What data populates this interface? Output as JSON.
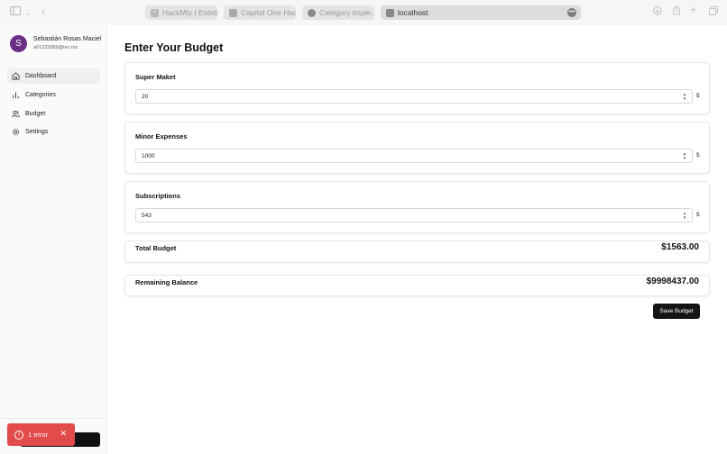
{
  "browser": {
    "tabs": [
      {
        "label": "HackMty | Esteb...",
        "icon": "tab-favicon"
      },
      {
        "label": "Capital One Hac...",
        "icon": "folder-icon"
      },
      {
        "label": "Category imple...",
        "icon": "github-icon"
      },
      {
        "label": "localhost",
        "icon": "page-icon"
      }
    ]
  },
  "sidebar": {
    "user": {
      "initial": "S",
      "name": "Sebastián Rosas Maciel",
      "email": "a01233989@tec.mx"
    },
    "items": [
      {
        "label": "Dashboard",
        "icon": "home-icon"
      },
      {
        "label": "Categories",
        "icon": "bar-chart-icon"
      },
      {
        "label": "Budget",
        "icon": "users-icon"
      },
      {
        "label": "Settings",
        "icon": "gear-icon"
      }
    ]
  },
  "main": {
    "title": "Enter Your Budget",
    "fields": [
      {
        "label": "Super Maket",
        "value": "20",
        "currency": "$"
      },
      {
        "label": "Minor Expenses",
        "value": "1000",
        "currency": "$"
      },
      {
        "label": "Subscriptions",
        "value": "543",
        "currency": "$"
      }
    ],
    "total": {
      "label": "Total Budget",
      "value": "$1563.00"
    },
    "remaining": {
      "label": "Remaining Balance",
      "value": "$9998437.00"
    },
    "save_label": "Save Budget"
  },
  "toast": {
    "label": "1 error"
  },
  "colors": {
    "avatar": "#6b2f86",
    "toast": "#e24b4b",
    "button": "#141414"
  }
}
